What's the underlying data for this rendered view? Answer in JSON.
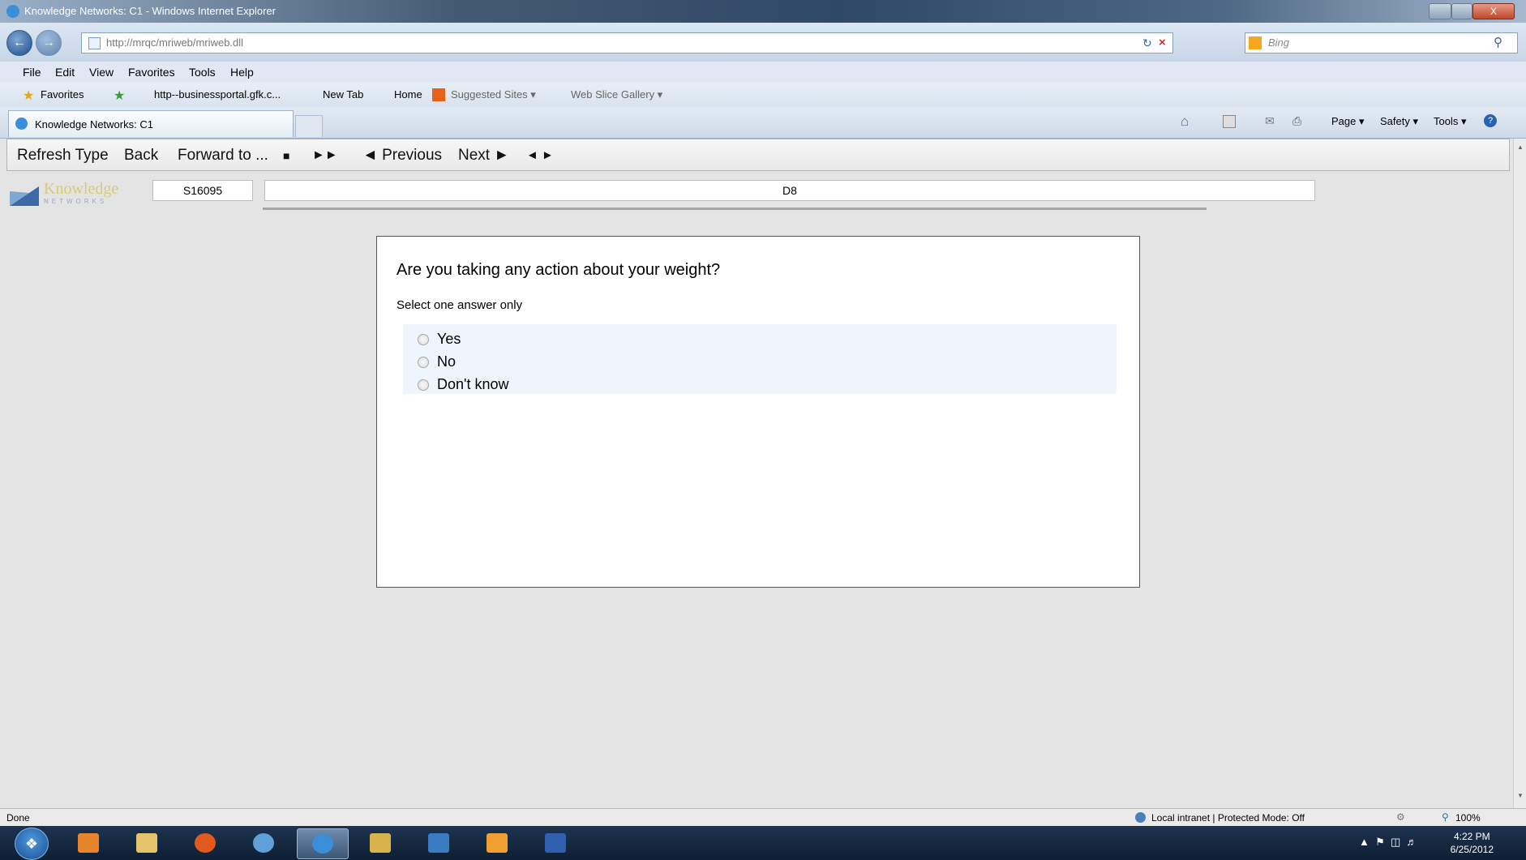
{
  "window": {
    "title": "Knowledge Networks: C1 - Windows Internet Explorer",
    "close_label": "X"
  },
  "address": {
    "url": "http://mrqc/mriweb/mriweb.dll",
    "search_placeholder": "Bing"
  },
  "menu": [
    "File",
    "Edit",
    "View",
    "Favorites",
    "Tools",
    "Help"
  ],
  "favorites": {
    "label": "Favorites",
    "items": [
      "http--businessportal.gfk.c...",
      "New Tab",
      "Home",
      "Suggested Sites ▾",
      "Web Slice Gallery ▾"
    ]
  },
  "tab": {
    "title": "Knowledge Networks: C1"
  },
  "commandbar": {
    "page": "Page ▾",
    "safety": "Safety ▾",
    "tools": "Tools ▾"
  },
  "survey_toolbar": {
    "refresh": "Refresh Type",
    "back": "Back",
    "forward": "Forward to ...",
    "stop": "■",
    "fast_forward": "►►",
    "previous": "◄ Previous",
    "next": "Next ►",
    "toggle": "◄ ►"
  },
  "logo": {
    "name": "Knowledge",
    "sub": "NETWORKS"
  },
  "respondent_id": "S16095",
  "question_id": "D8",
  "question": {
    "text": "Are you taking any action about your weight?",
    "instruction": "Select one answer only",
    "options": [
      "Yes",
      "No",
      "Don't know"
    ]
  },
  "status": {
    "left": "Done",
    "zone": "Local intranet | Protected Mode: Off",
    "zoom": "100%"
  },
  "clock": {
    "time": "4:22 PM",
    "date": "6/25/2012"
  }
}
